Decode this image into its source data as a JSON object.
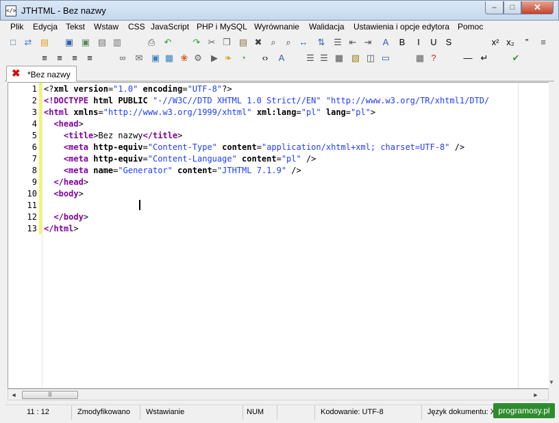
{
  "window": {
    "title": "JTHTML - Bez nazwy",
    "app_icon": "</>",
    "minimize_icon": "–",
    "maximize_icon": "□",
    "close_icon": "✕"
  },
  "menu": {
    "items": [
      "Plik",
      "Edycja",
      "Tekst",
      "Wstaw",
      "CSS",
      "JavaScript",
      "PHP i MySQL",
      "Wyrównanie",
      "Walidacja",
      "Ustawienia i opcje edytora",
      "Pomoc"
    ]
  },
  "toolbar1": {
    "icons": [
      {
        "name": "new-document-icon",
        "glyph": "□",
        "color": "#5a6f8a"
      },
      {
        "name": "new-template-icon",
        "glyph": "⇄",
        "color": "#3b7fd1"
      },
      {
        "name": "open-folder-icon",
        "glyph": "▤",
        "color": "#e0a020"
      },
      {
        "name": "save-icon",
        "glyph": "▣",
        "color": "#2d5fb0"
      },
      {
        "name": "save-as-icon",
        "glyph": "▣",
        "color": "#5a8a5a"
      },
      {
        "name": "save-all-icon",
        "glyph": "▤",
        "color": "#707070"
      },
      {
        "name": "close-file-icon",
        "glyph": "▥",
        "color": "#707070"
      },
      {
        "name": "print-icon",
        "glyph": "⎙",
        "color": "#505050"
      },
      {
        "name": "undo-icon",
        "glyph": "↶",
        "color": "#2e9a2e"
      },
      {
        "name": "redo-icon",
        "glyph": "↷",
        "color": "#2e9a2e"
      },
      {
        "name": "cut-icon",
        "glyph": "✂",
        "color": "#606060"
      },
      {
        "name": "copy-icon",
        "glyph": "❐",
        "color": "#606060"
      },
      {
        "name": "paste-icon",
        "glyph": "▤",
        "color": "#907040"
      },
      {
        "name": "delete-icon",
        "glyph": "✖",
        "color": "#404040"
      },
      {
        "name": "find-icon",
        "glyph": "⌕",
        "color": "#404040"
      },
      {
        "name": "find-next-icon",
        "glyph": "⌕",
        "color": "#404040"
      },
      {
        "name": "replace-icon",
        "glyph": "↔",
        "color": "#3060b0"
      },
      {
        "name": "sort-icon",
        "glyph": "⇅",
        "color": "#3060b0"
      },
      {
        "name": "indent-list-icon",
        "glyph": "☰",
        "color": "#505050"
      },
      {
        "name": "outdent-icon",
        "glyph": "⇤",
        "color": "#505050"
      },
      {
        "name": "indent-icon",
        "glyph": "⇥",
        "color": "#505050"
      },
      {
        "name": "font-style-icon",
        "glyph": "A",
        "color": "#3060b0"
      },
      {
        "name": "bold-icon",
        "glyph": "B",
        "color": "#000000"
      },
      {
        "name": "italic-icon",
        "glyph": "I",
        "color": "#000000"
      },
      {
        "name": "underline-icon",
        "glyph": "U",
        "color": "#000000"
      },
      {
        "name": "strikethrough-icon",
        "glyph": "S",
        "color": "#000000"
      },
      {
        "name": "superscript-icon",
        "glyph": "x²",
        "color": "#000000"
      },
      {
        "name": "subscript-icon",
        "glyph": "x₂",
        "color": "#000000"
      },
      {
        "name": "quote-icon",
        "glyph": "”",
        "color": "#000000"
      },
      {
        "name": "list-icon",
        "glyph": "≡",
        "color": "#505050"
      }
    ]
  },
  "toolbar2": {
    "icons": [
      {
        "name": "align-left-icon",
        "glyph": "≡",
        "color": "#000000"
      },
      {
        "name": "align-center-icon",
        "glyph": "≡",
        "color": "#000000"
      },
      {
        "name": "align-right-icon",
        "glyph": "≡",
        "color": "#000000"
      },
      {
        "name": "align-justify-icon",
        "glyph": "≡",
        "color": "#000000"
      },
      {
        "name": "link-icon",
        "glyph": "∞",
        "color": "#606060"
      },
      {
        "name": "email-icon",
        "glyph": "✉",
        "color": "#606060"
      },
      {
        "name": "image-icon",
        "glyph": "▣",
        "color": "#3a80c0"
      },
      {
        "name": "gallery-icon",
        "glyph": "▦",
        "color": "#3a80c0"
      },
      {
        "name": "color-palette-icon",
        "glyph": "❀",
        "color": "#d06020"
      },
      {
        "name": "flash-icon",
        "glyph": "⚙",
        "color": "#606060"
      },
      {
        "name": "media-icon",
        "glyph": "▶",
        "color": "#606060"
      },
      {
        "name": "script-icon",
        "glyph": "❧",
        "color": "#d0a020"
      },
      {
        "name": "timer-icon",
        "glyph": "◔",
        "color": "#40a040"
      },
      {
        "name": "code-brackets-icon",
        "glyph": "‹›",
        "color": "#000000"
      },
      {
        "name": "text-format-icon",
        "glyph": "A",
        "color": "#3060b0"
      },
      {
        "name": "unordered-list-icon",
        "glyph": "☰",
        "color": "#505050"
      },
      {
        "name": "ordered-list-icon",
        "glyph": "☰",
        "color": "#505050"
      },
      {
        "name": "table-icon",
        "glyph": "▦",
        "color": "#505050"
      },
      {
        "name": "table-edit-icon",
        "glyph": "▧",
        "color": "#a08020"
      },
      {
        "name": "layout-icon",
        "glyph": "◫",
        "color": "#505050"
      },
      {
        "name": "form-icon",
        "glyph": "▭",
        "color": "#3060b0"
      },
      {
        "name": "calculator-icon",
        "glyph": "▦",
        "color": "#606060"
      },
      {
        "name": "help-icon",
        "glyph": "?",
        "color": "#d02020"
      },
      {
        "name": "horizontal-rule-icon",
        "glyph": "—",
        "color": "#000000"
      },
      {
        "name": "line-break-icon",
        "glyph": "↵",
        "color": "#000000"
      },
      {
        "name": "validate-icon",
        "glyph": "✔",
        "color": "#2e9a2e"
      }
    ]
  },
  "tabs": [
    {
      "label": "*Bez nazwy",
      "close_icon": "✖"
    }
  ],
  "editor": {
    "line_numbers": [
      "1",
      "2",
      "3",
      "4",
      "5",
      "6",
      "7",
      "8",
      "9",
      "10",
      "11",
      "12",
      "13"
    ],
    "lines": [
      [
        {
          "c": "punct",
          "t": "<?"
        },
        {
          "c": "attr",
          "t": "xml version"
        },
        {
          "c": "punct",
          "t": "="
        },
        {
          "c": "str",
          "t": "\"1.0\""
        },
        {
          "c": "attr",
          "t": " encoding"
        },
        {
          "c": "punct",
          "t": "="
        },
        {
          "c": "str",
          "t": "\"UTF-8\""
        },
        {
          "c": "punct",
          "t": "?>"
        }
      ],
      [
        {
          "c": "kw",
          "t": "<!DOCTYPE"
        },
        {
          "c": "attr",
          "t": " html PUBLIC "
        },
        {
          "c": "str",
          "t": "\"-//W3C//DTD XHTML 1.0 Strict//EN\""
        },
        {
          "c": "str",
          "t": " \"http://www.w3.org/TR/xhtml1/DTD/"
        }
      ],
      [
        {
          "c": "kw",
          "t": "<html"
        },
        {
          "c": "attr",
          "t": " xmlns"
        },
        {
          "c": "punct",
          "t": "="
        },
        {
          "c": "str",
          "t": "\"http://www.w3.org/1999/xhtml\""
        },
        {
          "c": "attr",
          "t": " xml:lang"
        },
        {
          "c": "punct",
          "t": "="
        },
        {
          "c": "str",
          "t": "\"pl\""
        },
        {
          "c": "attr",
          "t": " lang"
        },
        {
          "c": "punct",
          "t": "="
        },
        {
          "c": "str",
          "t": "\"pl\""
        },
        {
          "c": "punct",
          "t": ">"
        }
      ],
      [
        {
          "c": "txt",
          "t": "  "
        },
        {
          "c": "kw",
          "t": "<head"
        },
        {
          "c": "punct",
          "t": ">"
        }
      ],
      [
        {
          "c": "txt",
          "t": "    "
        },
        {
          "c": "kw",
          "t": "<title"
        },
        {
          "c": "punct",
          "t": ">"
        },
        {
          "c": "txt",
          "t": "Bez nazwy"
        },
        {
          "c": "kw",
          "t": "</title"
        },
        {
          "c": "punct",
          "t": ">"
        }
      ],
      [
        {
          "c": "txt",
          "t": "    "
        },
        {
          "c": "kw",
          "t": "<meta"
        },
        {
          "c": "attr",
          "t": " http-equiv"
        },
        {
          "c": "punct",
          "t": "="
        },
        {
          "c": "str",
          "t": "\"Content-Type\""
        },
        {
          "c": "attr",
          "t": " content"
        },
        {
          "c": "punct",
          "t": "="
        },
        {
          "c": "str",
          "t": "\"application/xhtml+xml; charset=UTF-8\""
        },
        {
          "c": "punct",
          "t": " />"
        }
      ],
      [
        {
          "c": "txt",
          "t": "    "
        },
        {
          "c": "kw",
          "t": "<meta"
        },
        {
          "c": "attr",
          "t": " http-equiv"
        },
        {
          "c": "punct",
          "t": "="
        },
        {
          "c": "str",
          "t": "\"Content-Language\""
        },
        {
          "c": "attr",
          "t": " content"
        },
        {
          "c": "punct",
          "t": "="
        },
        {
          "c": "str",
          "t": "\"pl\""
        },
        {
          "c": "punct",
          "t": " />"
        }
      ],
      [
        {
          "c": "txt",
          "t": "    "
        },
        {
          "c": "kw",
          "t": "<meta"
        },
        {
          "c": "attr",
          "t": " name"
        },
        {
          "c": "punct",
          "t": "="
        },
        {
          "c": "str",
          "t": "\"Generator\""
        },
        {
          "c": "attr",
          "t": " content"
        },
        {
          "c": "punct",
          "t": "="
        },
        {
          "c": "str",
          "t": "\"JTHTML 7.1.9\""
        },
        {
          "c": "punct",
          "t": " />"
        }
      ],
      [
        {
          "c": "txt",
          "t": "  "
        },
        {
          "c": "kw",
          "t": "</head"
        },
        {
          "c": "punct",
          "t": ">"
        }
      ],
      [
        {
          "c": "txt",
          "t": "  "
        },
        {
          "c": "kw",
          "t": "<body"
        },
        {
          "c": "punct",
          "t": ">"
        }
      ],
      [
        {
          "c": "txt",
          "t": ""
        }
      ],
      [
        {
          "c": "txt",
          "t": "  "
        },
        {
          "c": "kw",
          "t": "</body"
        },
        {
          "c": "punct",
          "t": ">"
        }
      ],
      [
        {
          "c": "kw",
          "t": "</html"
        },
        {
          "c": "punct",
          "t": ">"
        }
      ]
    ]
  },
  "scrollbar": {
    "left_arrow": "◄",
    "right_arrow": "►",
    "down_arrow": "▼",
    "thumb_grip": "|||"
  },
  "statusbar": {
    "position": "11 : 12",
    "modified": "Zmodyfikowano",
    "insert_mode": "Wstawianie",
    "num_lock": "NUM",
    "blank": "",
    "encoding": "Kodowanie: UTF-8",
    "doc_language": "Język dokumentu: X"
  },
  "watermark": {
    "text": "programosy.pl"
  },
  "colors": {
    "tag": "#8000a0",
    "string": "#1e3cff",
    "gutter_marker": "#f5f565",
    "close_button": "#c4442b",
    "watermark_bg": "#2e8b2e"
  }
}
